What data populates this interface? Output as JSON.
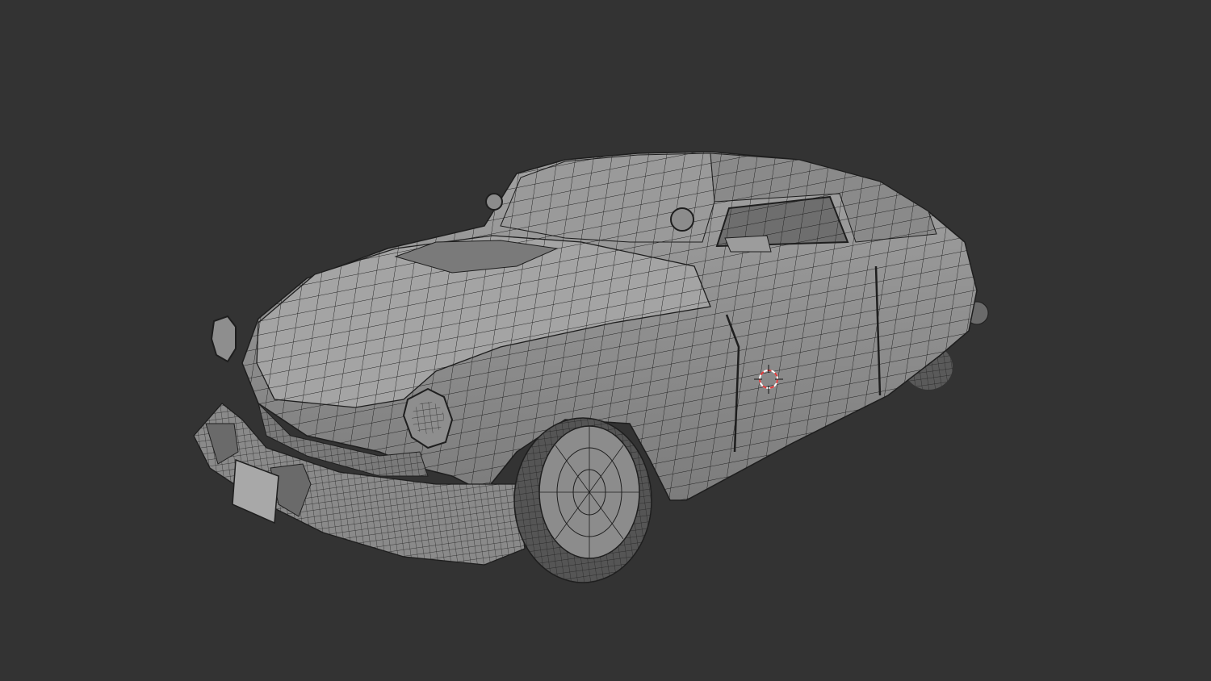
{
  "viewport": {
    "background_color": "#333333",
    "mesh_color": "#8e8e8e",
    "wire_color": "#1e1e1e",
    "cursor_colors": [
      "#e03a3a",
      "#ffffff"
    ]
  },
  "scene": {
    "object_icon": "car-mesh",
    "cursor_icon": "3d-cursor-icon"
  }
}
